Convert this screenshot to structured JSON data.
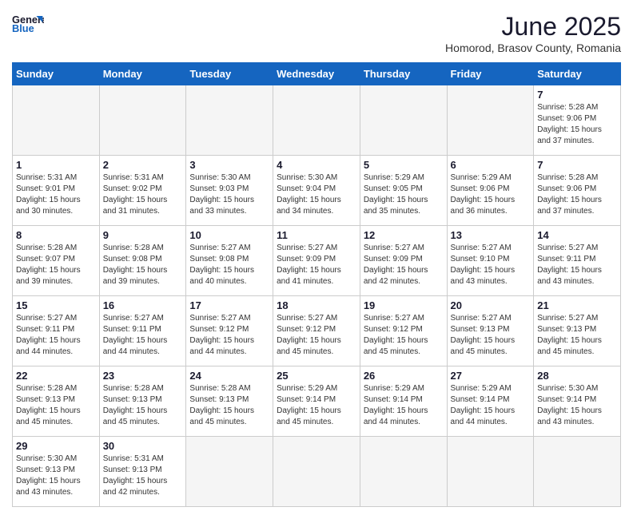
{
  "header": {
    "logo_general": "General",
    "logo_blue": "Blue",
    "month_title": "June 2025",
    "subtitle": "Homorod, Brasov County, Romania"
  },
  "calendar": {
    "days_of_week": [
      "Sunday",
      "Monday",
      "Tuesday",
      "Wednesday",
      "Thursday",
      "Friday",
      "Saturday"
    ],
    "weeks": [
      [
        null,
        null,
        null,
        null,
        null,
        null,
        null
      ]
    ],
    "cells": [
      {
        "day": null,
        "info": ""
      },
      {
        "day": null,
        "info": ""
      },
      {
        "day": null,
        "info": ""
      },
      {
        "day": null,
        "info": ""
      },
      {
        "day": null,
        "info": ""
      },
      {
        "day": null,
        "info": ""
      },
      {
        "day": null,
        "info": ""
      }
    ],
    "rows": [
      [
        {
          "day": null,
          "empty": true
        },
        {
          "day": null,
          "empty": true
        },
        {
          "day": null,
          "empty": true
        },
        {
          "day": null,
          "empty": true
        },
        {
          "day": null,
          "empty": true
        },
        {
          "day": null,
          "empty": true
        },
        {
          "day": 7,
          "sunrise": "5:28 AM",
          "sunset": "9:06 PM",
          "daylight": "15 hours and 37 minutes."
        }
      ],
      [
        {
          "day": 1,
          "sunrise": "5:31 AM",
          "sunset": "9:01 PM",
          "daylight": "15 hours and 30 minutes."
        },
        {
          "day": 2,
          "sunrise": "5:31 AM",
          "sunset": "9:02 PM",
          "daylight": "15 hours and 31 minutes."
        },
        {
          "day": 3,
          "sunrise": "5:30 AM",
          "sunset": "9:03 PM",
          "daylight": "15 hours and 33 minutes."
        },
        {
          "day": 4,
          "sunrise": "5:30 AM",
          "sunset": "9:04 PM",
          "daylight": "15 hours and 34 minutes."
        },
        {
          "day": 5,
          "sunrise": "5:29 AM",
          "sunset": "9:05 PM",
          "daylight": "15 hours and 35 minutes."
        },
        {
          "day": 6,
          "sunrise": "5:29 AM",
          "sunset": "9:06 PM",
          "daylight": "15 hours and 36 minutes."
        },
        {
          "day": 7,
          "sunrise": "5:28 AM",
          "sunset": "9:06 PM",
          "daylight": "15 hours and 37 minutes."
        }
      ],
      [
        {
          "day": 8,
          "sunrise": "5:28 AM",
          "sunset": "9:07 PM",
          "daylight": "15 hours and 39 minutes."
        },
        {
          "day": 9,
          "sunrise": "5:28 AM",
          "sunset": "9:08 PM",
          "daylight": "15 hours and 39 minutes."
        },
        {
          "day": 10,
          "sunrise": "5:27 AM",
          "sunset": "9:08 PM",
          "daylight": "15 hours and 40 minutes."
        },
        {
          "day": 11,
          "sunrise": "5:27 AM",
          "sunset": "9:09 PM",
          "daylight": "15 hours and 41 minutes."
        },
        {
          "day": 12,
          "sunrise": "5:27 AM",
          "sunset": "9:09 PM",
          "daylight": "15 hours and 42 minutes."
        },
        {
          "day": 13,
          "sunrise": "5:27 AM",
          "sunset": "9:10 PM",
          "daylight": "15 hours and 43 minutes."
        },
        {
          "day": 14,
          "sunrise": "5:27 AM",
          "sunset": "9:11 PM",
          "daylight": "15 hours and 43 minutes."
        }
      ],
      [
        {
          "day": 15,
          "sunrise": "5:27 AM",
          "sunset": "9:11 PM",
          "daylight": "15 hours and 44 minutes."
        },
        {
          "day": 16,
          "sunrise": "5:27 AM",
          "sunset": "9:11 PM",
          "daylight": "15 hours and 44 minutes."
        },
        {
          "day": 17,
          "sunrise": "5:27 AM",
          "sunset": "9:12 PM",
          "daylight": "15 hours and 44 minutes."
        },
        {
          "day": 18,
          "sunrise": "5:27 AM",
          "sunset": "9:12 PM",
          "daylight": "15 hours and 45 minutes."
        },
        {
          "day": 19,
          "sunrise": "5:27 AM",
          "sunset": "9:12 PM",
          "daylight": "15 hours and 45 minutes."
        },
        {
          "day": 20,
          "sunrise": "5:27 AM",
          "sunset": "9:13 PM",
          "daylight": "15 hours and 45 minutes."
        },
        {
          "day": 21,
          "sunrise": "5:27 AM",
          "sunset": "9:13 PM",
          "daylight": "15 hours and 45 minutes."
        }
      ],
      [
        {
          "day": 22,
          "sunrise": "5:28 AM",
          "sunset": "9:13 PM",
          "daylight": "15 hours and 45 minutes."
        },
        {
          "day": 23,
          "sunrise": "5:28 AM",
          "sunset": "9:13 PM",
          "daylight": "15 hours and 45 minutes."
        },
        {
          "day": 24,
          "sunrise": "5:28 AM",
          "sunset": "9:13 PM",
          "daylight": "15 hours and 45 minutes."
        },
        {
          "day": 25,
          "sunrise": "5:29 AM",
          "sunset": "9:14 PM",
          "daylight": "15 hours and 45 minutes."
        },
        {
          "day": 26,
          "sunrise": "5:29 AM",
          "sunset": "9:14 PM",
          "daylight": "15 hours and 44 minutes."
        },
        {
          "day": 27,
          "sunrise": "5:29 AM",
          "sunset": "9:14 PM",
          "daylight": "15 hours and 44 minutes."
        },
        {
          "day": 28,
          "sunrise": "5:30 AM",
          "sunset": "9:14 PM",
          "daylight": "15 hours and 43 minutes."
        }
      ],
      [
        {
          "day": 29,
          "sunrise": "5:30 AM",
          "sunset": "9:13 PM",
          "daylight": "15 hours and 43 minutes."
        },
        {
          "day": 30,
          "sunrise": "5:31 AM",
          "sunset": "9:13 PM",
          "daylight": "15 hours and 42 minutes."
        },
        {
          "day": null,
          "empty": true
        },
        {
          "day": null,
          "empty": true
        },
        {
          "day": null,
          "empty": true
        },
        {
          "day": null,
          "empty": true
        },
        {
          "day": null,
          "empty": true
        }
      ]
    ]
  }
}
